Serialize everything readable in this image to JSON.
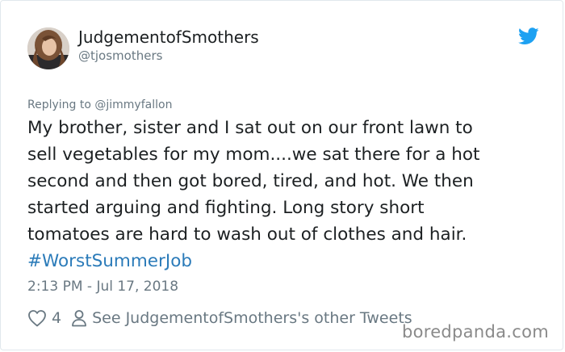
{
  "author": {
    "display_name": "JudgementofSmothers",
    "handle": "@tjosmothers"
  },
  "reply": {
    "text": "Replying to @jimmyfallon"
  },
  "tweet": {
    "lines": [
      "My brother, sister and I sat out on our front lawn to",
      "sell vegetables for my mom....we sat there for a hot",
      "second and then got bored, tired, and hot. We then",
      "started arguing and fighting. Long story short",
      "tomatoes are hard to wash out of clothes and hair."
    ],
    "hashtag": "#WorstSummerJob",
    "timestamp": "2:13 PM - Jul 17, 2018"
  },
  "actions": {
    "like_icon": "heart-icon",
    "like_count": "4",
    "profile_icon": "person-icon",
    "other_tweets_label": "See JudgementofSmothers's other Tweets"
  },
  "watermark": {
    "text": "boredpanda.com"
  },
  "colors": {
    "text": "#1c2022",
    "muted": "#697882",
    "link": "#2b7bb9",
    "twitter_blue": "#1da1f2"
  }
}
